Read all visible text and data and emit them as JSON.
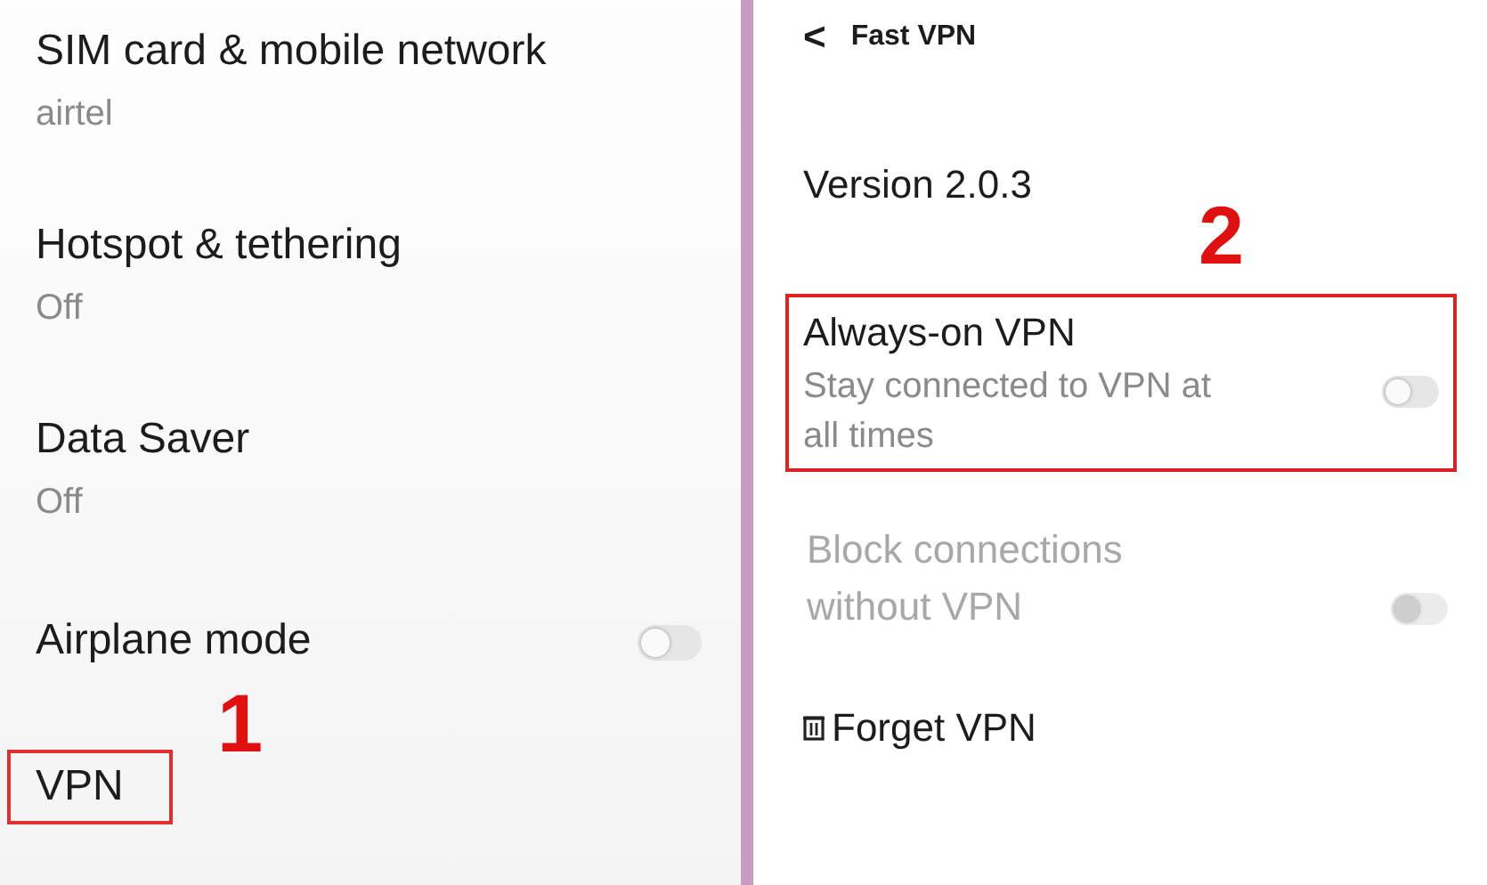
{
  "left_settings": [
    {
      "kind": "info",
      "title": "SIM card & mobile network",
      "subtitle": "airtel"
    },
    {
      "kind": "info",
      "title": "Hotspot & tethering",
      "subtitle": "Off"
    },
    {
      "kind": "info",
      "title": "Data Saver",
      "subtitle": "Off"
    },
    {
      "kind": "toggle",
      "title": "Airplane mode",
      "on": false
    },
    {
      "kind": "link",
      "title": "VPN",
      "step": "1"
    }
  ],
  "vpn_screen": {
    "header": {
      "back": "<",
      "title": "Fast VPN"
    },
    "version": "Version 2.0.3",
    "options": [
      {
        "kind": "toggle",
        "title": "Always-on VPN",
        "subtitle": "Stay connected to VPN at all times",
        "on": false,
        "disabled": false,
        "step": "2"
      },
      {
        "kind": "toggle",
        "title": "Block connections without VPN",
        "on": false,
        "disabled": true
      },
      {
        "kind": "action",
        "title": "Forget VPN"
      }
    ]
  }
}
